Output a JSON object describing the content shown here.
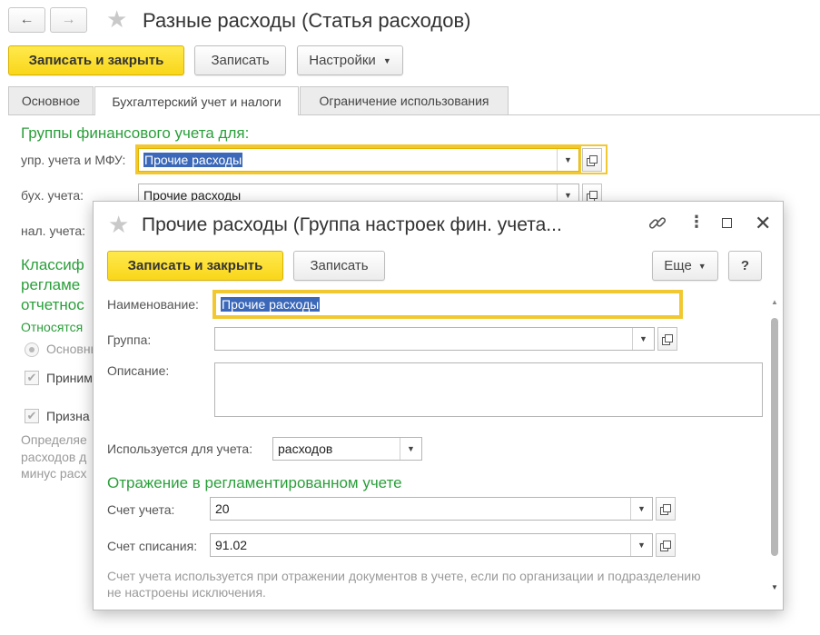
{
  "window": {
    "title": "Разные расходы (Статья расходов)",
    "back_icon": "←",
    "forward_icon": "→",
    "star_icon": "★"
  },
  "toolbar": {
    "save_close": "Записать и закрыть",
    "save": "Записать",
    "settings": "Настройки"
  },
  "tabs": [
    {
      "label": "Основное"
    },
    {
      "label": "Бухгалтерский учет и налоги"
    },
    {
      "label": "Ограничение использования"
    }
  ],
  "main": {
    "section_title": "Группы финансового учета для:",
    "rows": [
      {
        "label": "упр. учета и МФУ:",
        "value": "Прочие расходы"
      },
      {
        "label": "бух. учета:",
        "value": "Прочие расходы"
      },
      {
        "label": "нал. учета:",
        "value": ""
      }
    ],
    "section2_lines": [
      "Классиф",
      "регламе",
      "отчетнос"
    ],
    "relates": "Относятся",
    "radio_label": "Основны",
    "check1_label": "Приним",
    "check2_label": "Призна",
    "note_lines": [
      "Определяе",
      "расходов д",
      "минус расх"
    ]
  },
  "dialog": {
    "title": "Прочие расходы (Группа настроек фин. учета...",
    "save_close": "Записать и закрыть",
    "save": "Записать",
    "more": "Еще",
    "help": "?",
    "name_label": "Наименование:",
    "name_value": "Прочие расходы",
    "group_label": "Группа:",
    "group_value": "",
    "desc_label": "Описание:",
    "desc_value": "",
    "used_for_label": "Используется для учета:",
    "used_for_value": "расходов",
    "section_title": "Отражение в регламентированном учете",
    "account_label": "Счет учета:",
    "account_value": "20",
    "writeoff_label": "Счет списания:",
    "writeoff_value": "91.02",
    "hint_line1": "Счет учета используется при отражении документов в учете, если по организации и подразделению",
    "hint_line2": "не настроены исключения."
  },
  "colors": {
    "accent_yellow": "#f9d61a",
    "section_green": "#2a9f3a",
    "selection_blue": "#3b68b8"
  }
}
